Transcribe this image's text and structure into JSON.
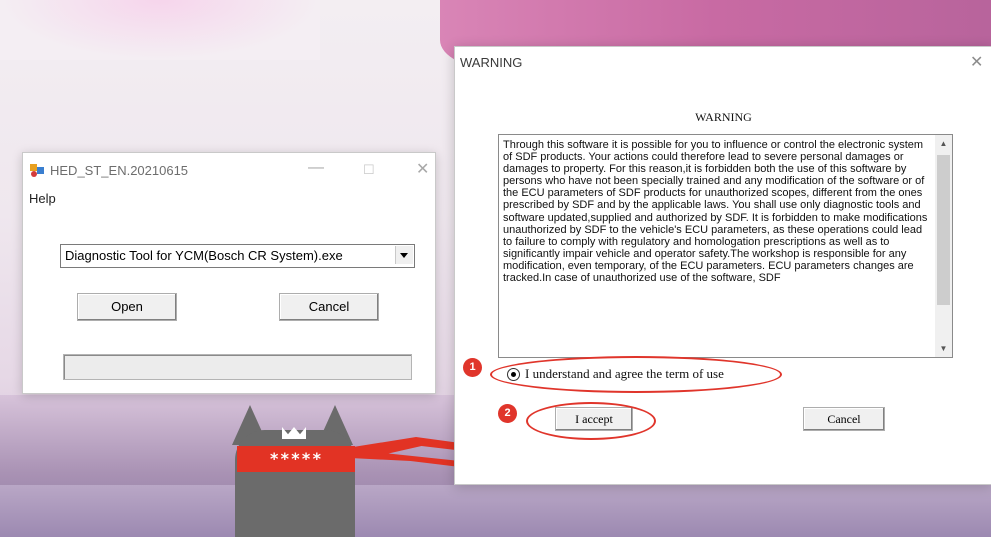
{
  "launcher": {
    "title": "HED_ST_EN.20210615",
    "controls": {
      "minimize": "—",
      "maximize": "☐",
      "close": "✕"
    },
    "menu": "Help",
    "select_value": "Diagnostic Tool for YCM(Bosch CR System).exe",
    "open_label": "Open",
    "cancel_label": "Cancel"
  },
  "warning": {
    "window_title": "WARNING",
    "close_glyph": "✕",
    "heading": "WARNING",
    "body": "   Through this software it is possible for you to influence or control the electronic system of SDF products. Your actions could therefore lead to severe personal damages or damages to property. For this reason,it is forbidden both the use of this software by persons who have not been specially trained and any modification of the software or of the ECU parameters of SDF products for unauthorized scopes, different from the ones prescribed by SDF and by the applicable laws. You shall use only diagnostic tools and software updated,supplied and authorized by SDF. It is forbidden to make modifications unauthorized by SDF to the vehicle's ECU parameters, as these operations could lead to failure to comply with regulatory and homologation prescriptions as well as to significantly impair vehicle and operator safety.The workshop is responsible for any modification, even temporary, of the ECU parameters. ECU parameters changes are tracked.In case of unauthorized use of the software, SDF",
    "scroll_up": "▲",
    "scroll_down": "▼",
    "agree_label": "I understand and agree the term of use",
    "agree_checked": true,
    "accept_label": "I accept",
    "cancel_label": "Cancel"
  },
  "annotations": {
    "step1": "1",
    "step2": "2",
    "color": "#e0352b"
  },
  "wallpaper": {
    "mask_text": "*****"
  }
}
